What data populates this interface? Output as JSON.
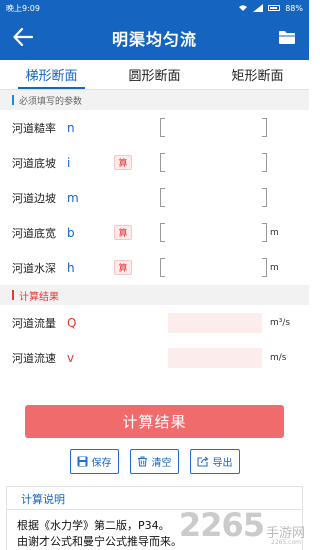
{
  "status_bar": {
    "time": "晚上9:09",
    "battery": "88%"
  },
  "app_bar": {
    "title": "明渠均匀流"
  },
  "tabs": [
    {
      "label": "梯形断面",
      "active": true
    },
    {
      "label": "圆形断面",
      "active": false
    },
    {
      "label": "矩形断面",
      "active": false
    }
  ],
  "required_section": {
    "title": "必须填写的参数"
  },
  "inputs": [
    {
      "label": "河道糙率",
      "symbol": "n",
      "calc": "",
      "unit": ""
    },
    {
      "label": "河道底坡",
      "symbol": "i",
      "calc": "算",
      "unit": ""
    },
    {
      "label": "河道边坡",
      "symbol": "m",
      "calc": "",
      "unit": ""
    },
    {
      "label": "河道底宽",
      "symbol": "b",
      "calc": "算",
      "unit": "m"
    },
    {
      "label": "河道水深",
      "symbol": "h",
      "calc": "算",
      "unit": "m"
    }
  ],
  "results_section": {
    "title": "计算结果"
  },
  "results": [
    {
      "label": "河道流量",
      "symbol": "Q",
      "unit": "m³/s",
      "value": ""
    },
    {
      "label": "河道流速",
      "symbol": "v",
      "unit": "m/s",
      "value": ""
    }
  ],
  "calc_button": {
    "label": "计算结果"
  },
  "actions": {
    "save": "保存",
    "clear": "清空",
    "export": "导出"
  },
  "note": {
    "title": "计算说明",
    "line1": "根据《水力学》第二版，P34。",
    "line2": "由谢才公式和曼宁公式推导而来。"
  },
  "watermark": {
    "number": "2265",
    "text": "手游网",
    "url": "2265.com"
  },
  "colors": {
    "primary": "#1565c0",
    "accent_red": "#e53935",
    "button_red": "#f06b6b"
  }
}
